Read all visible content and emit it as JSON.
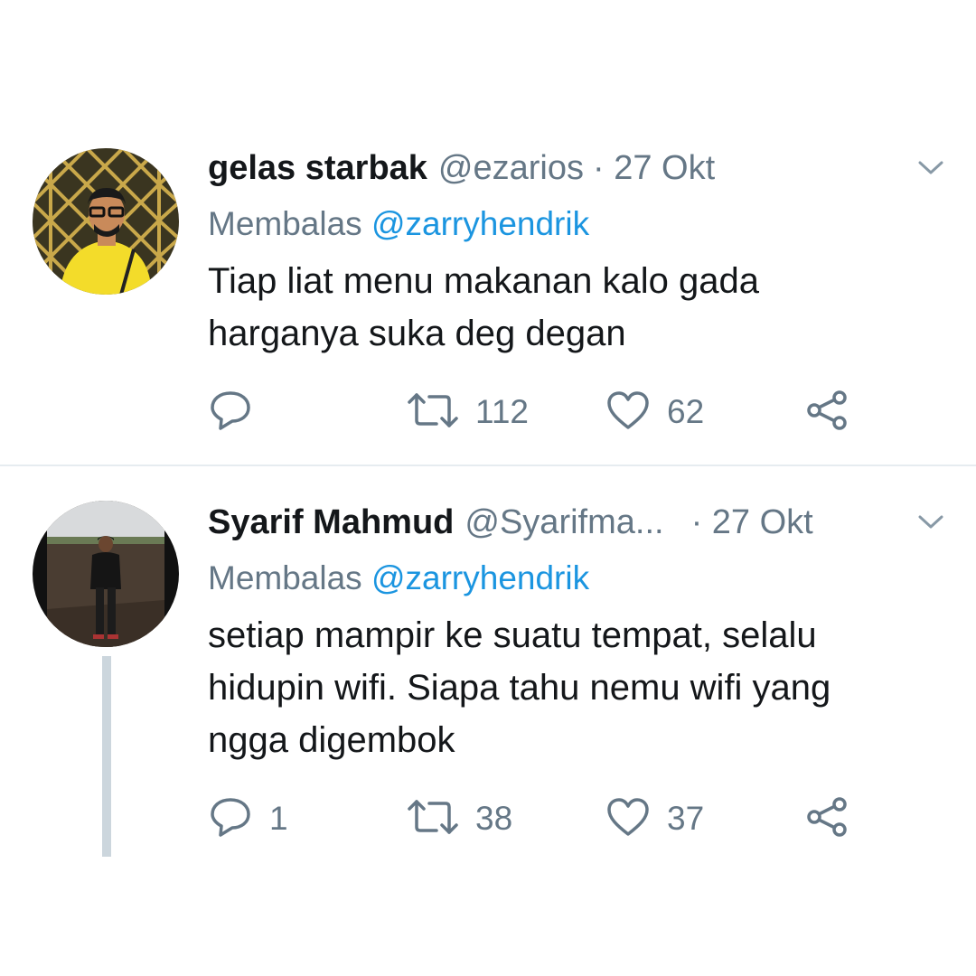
{
  "tweets": [
    {
      "name": "gelas starbak",
      "handle": "@ezarios",
      "date": "· 27 Okt",
      "reply_prefix": "Membalas",
      "reply_to": "@zarryhendrik",
      "text_lines": [
        "Tiap liat menu makanan kalo gada",
        "harganya suka deg degan"
      ],
      "replies": "",
      "retweets": "112",
      "likes": "62"
    },
    {
      "name": "Syarif Mahmud",
      "handle": "@Syarifma...",
      "date": "· 27 Okt",
      "reply_prefix": "Membalas",
      "reply_to": "@zarryhendrik",
      "text_lines": [
        "setiap mampir ke suatu tempat, selalu",
        "hidupin wifi. Siapa tahu nemu wifi yang",
        "ngga digembok"
      ],
      "replies": "1",
      "retweets": "38",
      "likes": "37"
    }
  ],
  "icons": {
    "reply": "reply-icon",
    "retweet": "retweet-icon",
    "like": "heart-icon",
    "share": "share-icon",
    "menu": "chevron-down-icon"
  },
  "colors": {
    "text": "#14171a",
    "secondary": "#657786",
    "link": "#1b95e0",
    "thread_line": "#ccd6dd"
  }
}
